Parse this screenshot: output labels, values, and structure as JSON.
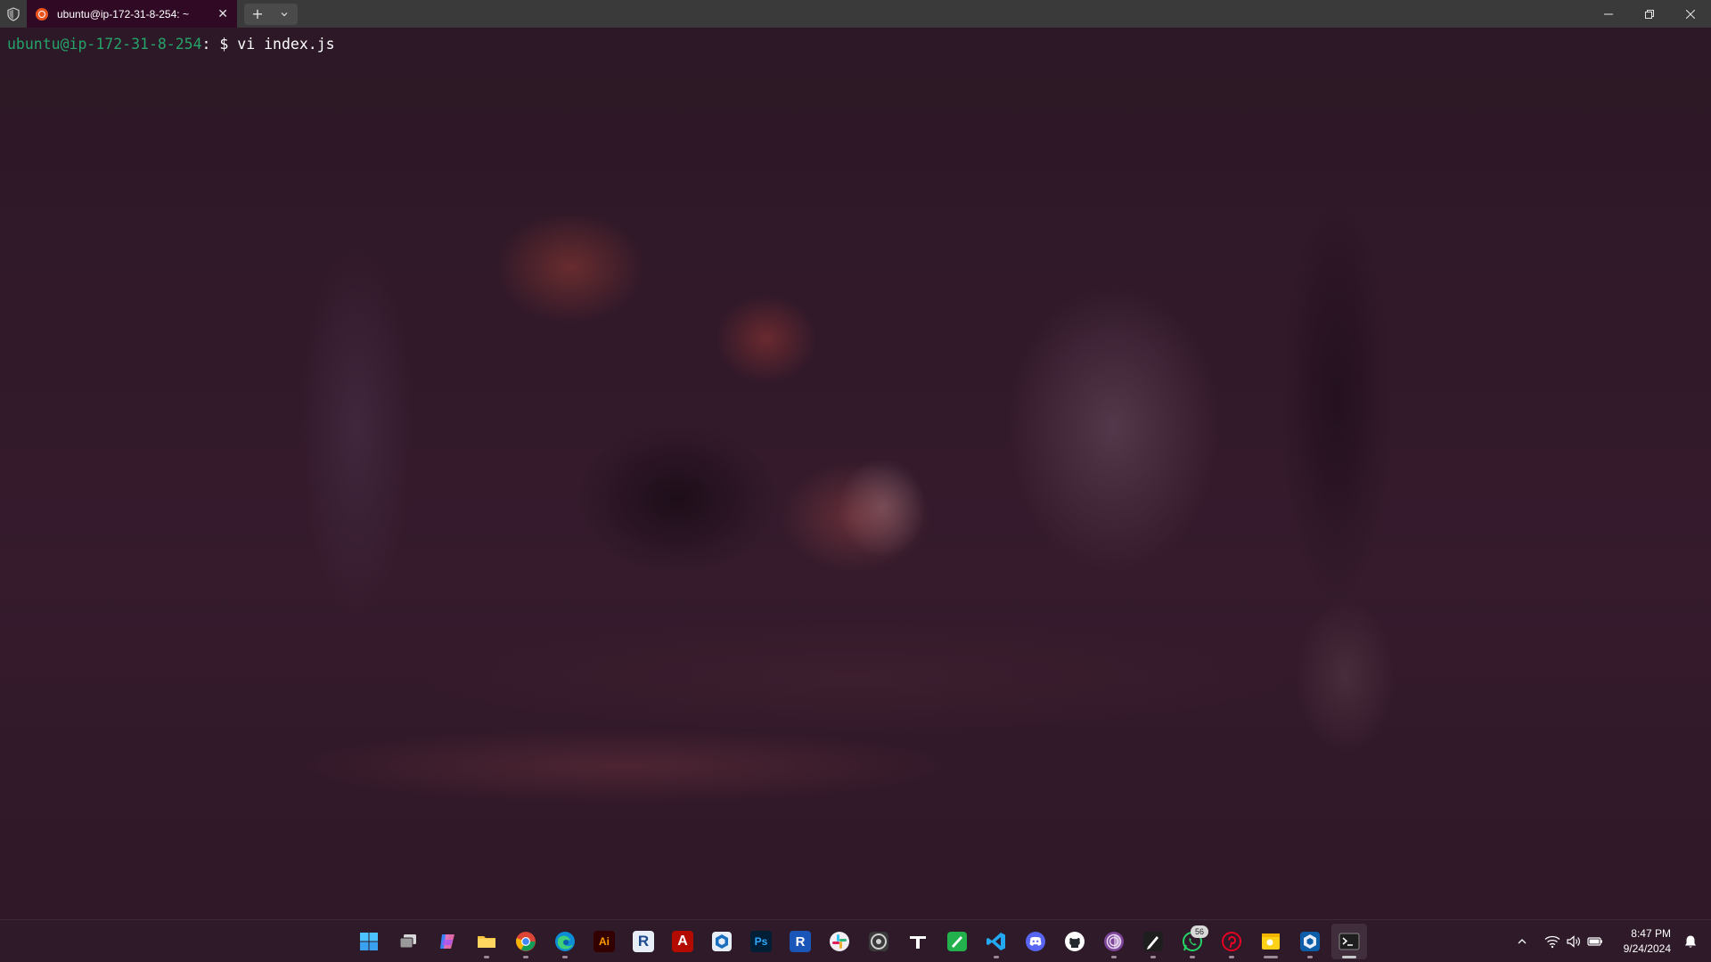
{
  "window": {
    "tab_title": "ubuntu@ip-172-31-8-254: ~",
    "tab_icon": "ubuntu-icon",
    "new_tab_symbol": "+",
    "dropdown_symbol": "⌄",
    "close_tab_symbol": "✕"
  },
  "terminal": {
    "prompt_user_host": "ubuntu@ip-172-31-8-254",
    "prompt_separator": ": $ ",
    "command": "vi index.js"
  },
  "taskbar": {
    "apps": [
      {
        "name": "start-icon",
        "label": ""
      },
      {
        "name": "task-view-icon",
        "label": ""
      },
      {
        "name": "copilot-icon",
        "label": ""
      },
      {
        "name": "file-explorer-icon",
        "label": ""
      },
      {
        "name": "chrome-icon",
        "label": ""
      },
      {
        "name": "edge-icon",
        "label": ""
      },
      {
        "name": "illustrator-icon",
        "label": "Ai"
      },
      {
        "name": "revit-icon",
        "label": "R"
      },
      {
        "name": "acrobat-icon",
        "label": "A"
      },
      {
        "name": "sketchup-icon",
        "label": ""
      },
      {
        "name": "photoshop-icon",
        "label": "Ps"
      },
      {
        "name": "revit-rvt-icon",
        "label": "R"
      },
      {
        "name": "slack-icon",
        "label": ""
      },
      {
        "name": "obs-icon",
        "label": ""
      },
      {
        "name": "typora-icon",
        "label": ""
      },
      {
        "name": "notes-icon",
        "label": ""
      },
      {
        "name": "vscode-icon",
        "label": ""
      },
      {
        "name": "discord-icon",
        "label": ""
      },
      {
        "name": "github-icon",
        "label": ""
      },
      {
        "name": "tor-browser-icon",
        "label": ""
      },
      {
        "name": "inkscape-icon",
        "label": ""
      },
      {
        "name": "whatsapp-icon",
        "label": "",
        "badge": "56"
      },
      {
        "name": "pinterest-icon",
        "label": ""
      },
      {
        "name": "sticky-notes-icon",
        "label": ""
      },
      {
        "name": "sketchup-layout-icon",
        "label": ""
      },
      {
        "name": "terminal-icon",
        "label": ""
      }
    ],
    "whatsapp_badge": "56",
    "clock_time": "8:47 PM",
    "clock_date": "9/24/2024"
  },
  "colors": {
    "terminal_bg": "#300a24",
    "prompt_green": "#26a269",
    "titlebar": "#3a3a3a"
  }
}
